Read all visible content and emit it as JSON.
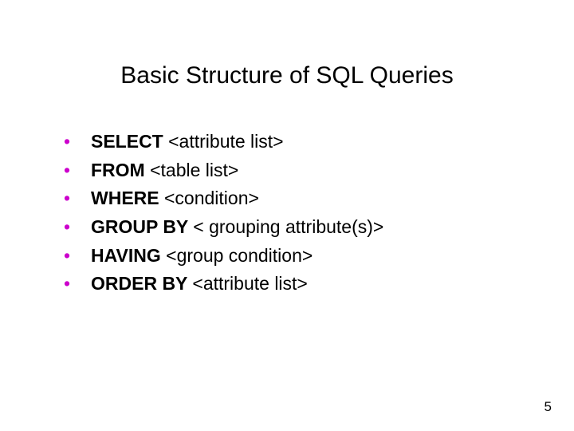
{
  "title": "Basic Structure of SQL Queries",
  "bullet_char": "•",
  "items": [
    {
      "keyword": "SELECT ",
      "arg": "<attribute list>"
    },
    {
      "keyword": "FROM ",
      "arg": "<table list>"
    },
    {
      "keyword": "WHERE ",
      "arg": "<condition>"
    },
    {
      "keyword": "GROUP BY ",
      "arg": "< grouping attribute(s)>"
    },
    {
      "keyword": "HAVING ",
      "arg": "<group condition>"
    },
    {
      "keyword": "ORDER BY ",
      "arg": "<attribute list>"
    }
  ],
  "page_number": "5"
}
